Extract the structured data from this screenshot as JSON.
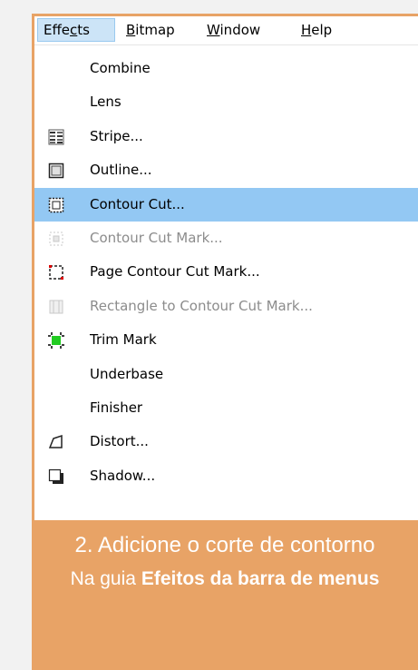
{
  "menubar": {
    "effects": {
      "pre": "Effe",
      "u": "c",
      "post": "ts"
    },
    "bitmap": {
      "pre": "",
      "u": "B",
      "post": "itmap"
    },
    "window": {
      "pre": "",
      "u": "W",
      "post": "indow"
    },
    "help": {
      "pre": "",
      "u": "H",
      "post": "elp"
    }
  },
  "menu": {
    "items": [
      {
        "label": "Combine",
        "icon": "none",
        "disabled": false,
        "highlighted": false
      },
      {
        "label": "Lens",
        "icon": "none",
        "disabled": false,
        "highlighted": false
      },
      {
        "label": "Stripe...",
        "icon": "stripe-icon",
        "disabled": false,
        "highlighted": false
      },
      {
        "label": "Outline...",
        "icon": "outline-icon",
        "disabled": false,
        "highlighted": false
      },
      {
        "label": "Contour Cut...",
        "icon": "contour-cut-icon",
        "disabled": false,
        "highlighted": true
      },
      {
        "label": "Contour Cut Mark...",
        "icon": "contour-cut-mark-icon",
        "disabled": true,
        "highlighted": false
      },
      {
        "label": "Page Contour Cut Mark...",
        "icon": "page-contour-cut-mark-icon",
        "disabled": false,
        "highlighted": false
      },
      {
        "label": "Rectangle to Contour Cut Mark...",
        "icon": "rectangle-cut-mark-icon",
        "disabled": true,
        "highlighted": false
      },
      {
        "label": "Trim Mark",
        "icon": "trim-mark-icon",
        "disabled": false,
        "highlighted": false
      },
      {
        "label": "Underbase",
        "icon": "none",
        "disabled": false,
        "highlighted": false
      },
      {
        "label": "Finisher",
        "icon": "none",
        "disabled": false,
        "highlighted": false
      },
      {
        "label": "Distort...",
        "icon": "distort-icon",
        "disabled": false,
        "highlighted": false
      },
      {
        "label": "Shadow...",
        "icon": "shadow-icon",
        "disabled": false,
        "highlighted": false
      }
    ]
  },
  "caption": {
    "step": "2. Adicione o corte de contorno",
    "prefix": "Na guia",
    "emphasis": "Efeitos da barra de menus"
  },
  "colors": {
    "accent": "#e8a366",
    "highlight": "#93c8f3"
  }
}
